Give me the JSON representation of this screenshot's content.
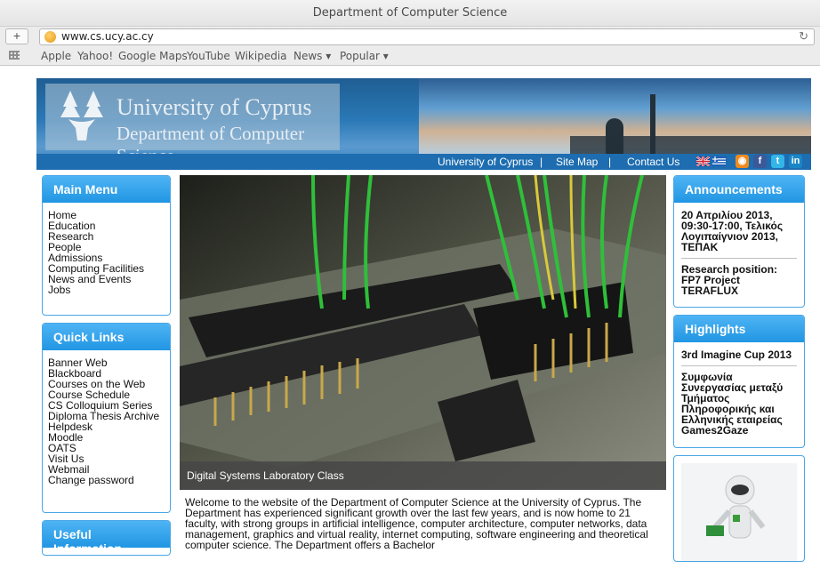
{
  "browser": {
    "window_title": "Department of Computer Science",
    "url": "www.cs.ucy.ac.cy",
    "bookmarks": [
      "Apple",
      "Yahoo!",
      "Google Maps",
      "YouTube",
      "Wikipedia",
      "News ▾",
      "Popular ▾"
    ]
  },
  "banner": {
    "logo_line1": "University of Cyprus",
    "logo_line2": "Department of Computer Science",
    "nav": [
      "University of Cyprus",
      "Site Map",
      "Contact Us"
    ],
    "nav_separator": "|",
    "social_icons": [
      "uk-flag-icon",
      "greek-flag-icon",
      "rss-icon",
      "facebook-icon",
      "twitter-icon",
      "linkedin-icon"
    ]
  },
  "main_menu": {
    "title": "Main Menu",
    "items": [
      "Home",
      "Education",
      "Research",
      "People",
      "Admissions",
      "Computing Facilities",
      "News and Events",
      "Jobs"
    ]
  },
  "quick_links": {
    "title": "Quick Links",
    "items": [
      "Banner Web",
      "Blackboard",
      "Courses on the Web",
      "Course Schedule",
      "CS Colloquium Series",
      "Diploma Thesis Archive",
      "Helpdesk",
      "Moodle",
      "OATS",
      "Visit Us",
      "Webmail",
      "Change password"
    ]
  },
  "useful_info": {
    "title": "Useful Information"
  },
  "hero": {
    "caption": "Digital Systems Laboratory Class"
  },
  "welcome_text": "Welcome to the website of the Department of Computer Science at the University of Cyprus. The Department has experienced significant growth over the last few years, and is now home to 21 faculty, with strong groups in artificial intelligence, computer architecture, computer networks, data management, graphics and virtual reality, internet computing, software engineering and theoretical computer science. The Department offers a Bachelor",
  "announcements": {
    "title": "Announcements",
    "items": [
      "20 Απριλίου 2013, 09:30-17:00, Τελικός Λογιπαίγνιον 2013, ΤΕΠΑΚ",
      "Research position: FP7 Project TERAFLUX"
    ]
  },
  "highlights": {
    "title": "Highlights",
    "items": [
      "3rd Imagine Cup 2013",
      "Συμφωνία Συνεργασίας μεταξύ Τμήματος Πληροφορικής και Ελληνικής εταιρείας Games2Gaze"
    ]
  },
  "colors": {
    "accent": "#2196e3",
    "banner": "#1d6db0"
  }
}
